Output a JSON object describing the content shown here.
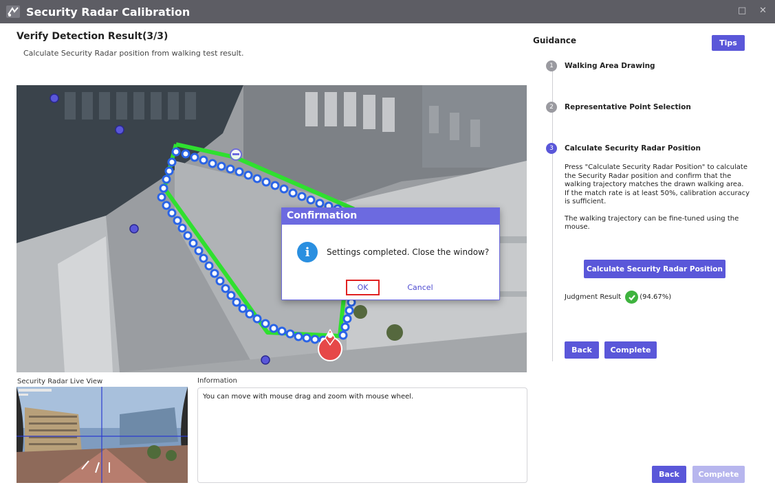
{
  "window": {
    "title": "Security Radar Calibration",
    "maximize_glyph": "□",
    "close_glyph": "✕"
  },
  "header": {
    "title": "Verify Detection Result(3/3)",
    "subtitle": "Calculate Security Radar position from walking test result."
  },
  "map": {
    "icon": "aerial-map"
  },
  "dialog": {
    "title": "Confirmation",
    "message": "Settings completed. Close the window?",
    "ok_label": "OK",
    "cancel_label": "Cancel"
  },
  "live_view": {
    "label": "Security Radar Live View"
  },
  "information": {
    "label": "Information",
    "text": "You can move with mouse drag and zoom with mouse wheel."
  },
  "guidance": {
    "title": "Guidance",
    "tips_label": "Tips",
    "steps": [
      {
        "num": "1",
        "label": "Walking Area Drawing"
      },
      {
        "num": "2",
        "label": "Representative Point Selection"
      },
      {
        "num": "3",
        "label": "Calculate Security Radar Position"
      }
    ],
    "description": {
      "p1": "Press \"Calculate Security Radar Position\" to calculate the Security Radar position and confirm that the walking trajectory matches the drawn walking area.",
      "p2": "If the match rate is at least 50%, calibration accuracy is sufficient.",
      "p3": "The walking trajectory can be fine-tuned using the mouse."
    },
    "calc_label": "Calculate Security Radar Position",
    "judgment_label": "Judgment Result",
    "judgment_value": "(94.67%)",
    "back_label": "Back",
    "complete_label": "Complete"
  },
  "footer": {
    "back_label": "Back",
    "complete_label": "Complete"
  },
  "colors": {
    "accent": "#5a57d9",
    "accent_disabled": "#b7b6ee",
    "titlebar": "#5d5d64",
    "success": "#3eb33e",
    "trajectory": "#2a64e6",
    "walking_area": "#2fe02f",
    "radar_marker": "#e64848",
    "ok_highlight": "#e02020"
  }
}
